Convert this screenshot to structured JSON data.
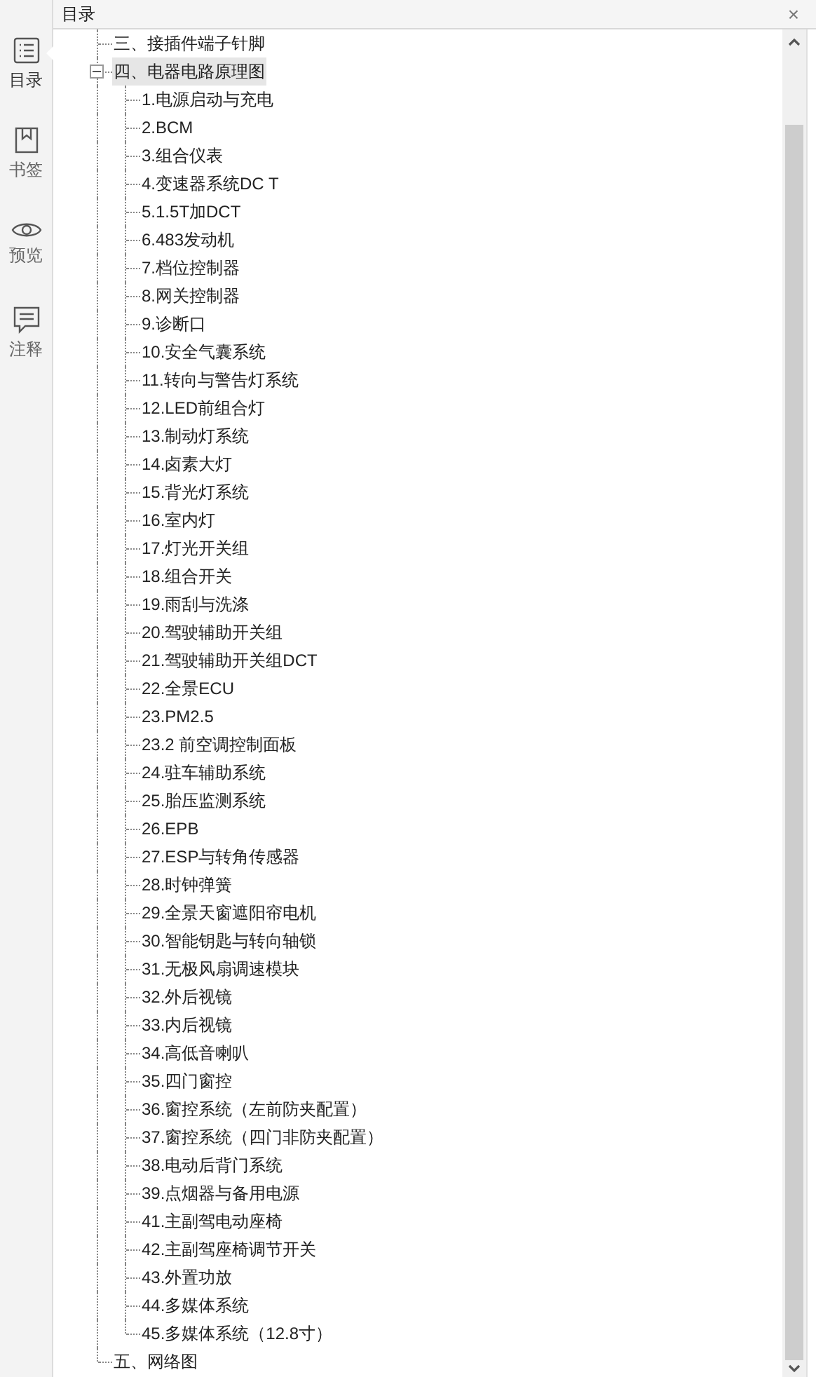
{
  "panel": {
    "title": "目录",
    "close": "×"
  },
  "rail": [
    {
      "label": "目录",
      "kind": "list",
      "selected": true
    },
    {
      "label": "书签",
      "kind": "bookmark",
      "selected": false
    },
    {
      "label": "预览",
      "kind": "eye",
      "selected": false
    },
    {
      "label": "注释",
      "kind": "comment",
      "selected": false
    }
  ],
  "tree": [
    {
      "label": "三、接插件端子针脚",
      "selected": false
    },
    {
      "label": "四、电器电路原理图",
      "selected": true,
      "expanded": true,
      "children": [
        {
          "label": "1.电源启动与充电",
          "selected": false
        },
        {
          "label": "2.BCM",
          "selected": false
        },
        {
          "label": "3.组合仪表",
          "selected": false
        },
        {
          "label": "4.变速器系统DC T",
          "selected": false
        },
        {
          "label": "5.1.5T加DCT",
          "selected": false
        },
        {
          "label": "6.483发动机",
          "selected": false
        },
        {
          "label": "7.档位控制器",
          "selected": false
        },
        {
          "label": "8.网关控制器",
          "selected": false
        },
        {
          "label": "9.诊断口",
          "selected": false
        },
        {
          "label": "10.安全气囊系统",
          "selected": false
        },
        {
          "label": "11.转向与警告灯系统",
          "selected": false
        },
        {
          "label": "12.LED前组合灯",
          "selected": false
        },
        {
          "label": "13.制动灯系统",
          "selected": false
        },
        {
          "label": "14.卤素大灯",
          "selected": false
        },
        {
          "label": "15.背光灯系统",
          "selected": false
        },
        {
          "label": "16.室内灯",
          "selected": false
        },
        {
          "label": "17.灯光开关组",
          "selected": false
        },
        {
          "label": "18.组合开关",
          "selected": false
        },
        {
          "label": "19.雨刮与洗涤",
          "selected": false
        },
        {
          "label": "20.驾驶辅助开关组",
          "selected": false
        },
        {
          "label": "21.驾驶辅助开关组DCT",
          "selected": false
        },
        {
          "label": "22.全景ECU",
          "selected": false
        },
        {
          "label": "23.PM2.5",
          "selected": false
        },
        {
          "label": "23.2 前空调控制面板",
          "selected": false
        },
        {
          "label": "24.驻车辅助系统",
          "selected": false
        },
        {
          "label": "25.胎压监测系统",
          "selected": false
        },
        {
          "label": "26.EPB",
          "selected": false
        },
        {
          "label": "27.ESP与转角传感器",
          "selected": false
        },
        {
          "label": "28.时钟弹簧",
          "selected": false
        },
        {
          "label": "29.全景天窗遮阳帘电机",
          "selected": false
        },
        {
          "label": "30.智能钥匙与转向轴锁",
          "selected": false
        },
        {
          "label": "31.无极风扇调速模块",
          "selected": false
        },
        {
          "label": "32.外后视镜",
          "selected": false
        },
        {
          "label": "33.内后视镜",
          "selected": false
        },
        {
          "label": "34.高低音喇叭",
          "selected": false
        },
        {
          "label": "35.四门窗控",
          "selected": false
        },
        {
          "label": "36.窗控系统（左前防夹配置）",
          "selected": false
        },
        {
          "label": "37.窗控系统（四门非防夹配置）",
          "selected": false
        },
        {
          "label": "38.电动后背门系统",
          "selected": false
        },
        {
          "label": "39.点烟器与备用电源",
          "selected": false
        },
        {
          "label": "41.主副驾电动座椅",
          "selected": false
        },
        {
          "label": "42.主副驾座椅调节开关",
          "selected": false
        },
        {
          "label": "43.外置功放",
          "selected": false
        },
        {
          "label": "44.多媒体系统",
          "selected": false
        },
        {
          "label": "45.多媒体系统（12.8寸）",
          "selected": false
        }
      ]
    },
    {
      "label": "五、网络图",
      "selected": false
    }
  ]
}
